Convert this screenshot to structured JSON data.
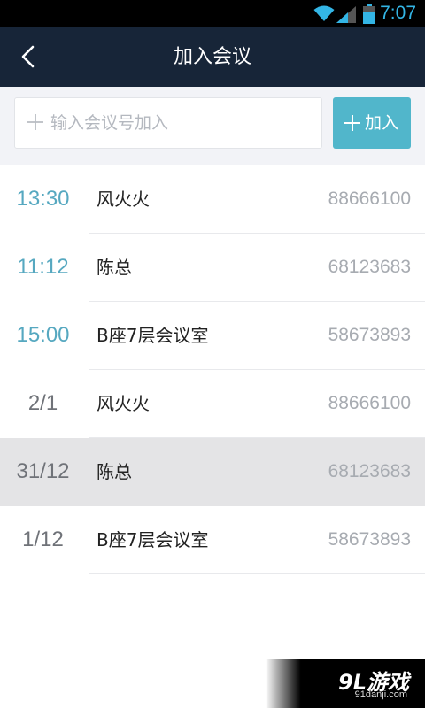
{
  "status_bar": {
    "time": "7:07",
    "wifi_icon": "wifi-icon",
    "signal_icon": "signal-icon",
    "battery_icon": "battery-icon"
  },
  "header": {
    "title": "加入会议",
    "back_icon": "chevron-left-icon"
  },
  "join": {
    "placeholder": "输入会议号加入",
    "button_label": "加入",
    "plus_icon": "plus-icon"
  },
  "meetings": [
    {
      "time": "13:30",
      "name": "风火火",
      "number": "88666100",
      "kind": "today"
    },
    {
      "time": "11:12",
      "name": "陈总",
      "number": "68123683",
      "kind": "today"
    },
    {
      "time": "15:00",
      "name": "B座7层会议室",
      "number": "58673893",
      "kind": "today"
    },
    {
      "time": "2/1",
      "name": "风火火",
      "number": "88666100",
      "kind": "past"
    },
    {
      "time": "31/12",
      "name": "陈总",
      "number": "68123683",
      "kind": "past"
    },
    {
      "time": "1/12",
      "name": "B座7层会议室",
      "number": "58673893",
      "kind": "past"
    }
  ],
  "watermark": {
    "logo": "9L游戏",
    "url": "91danji.com"
  },
  "colors": {
    "header_bg": "#172538",
    "accent": "#51b6cb",
    "time_today": "#56a8c0",
    "status_time": "#33b5e5"
  }
}
